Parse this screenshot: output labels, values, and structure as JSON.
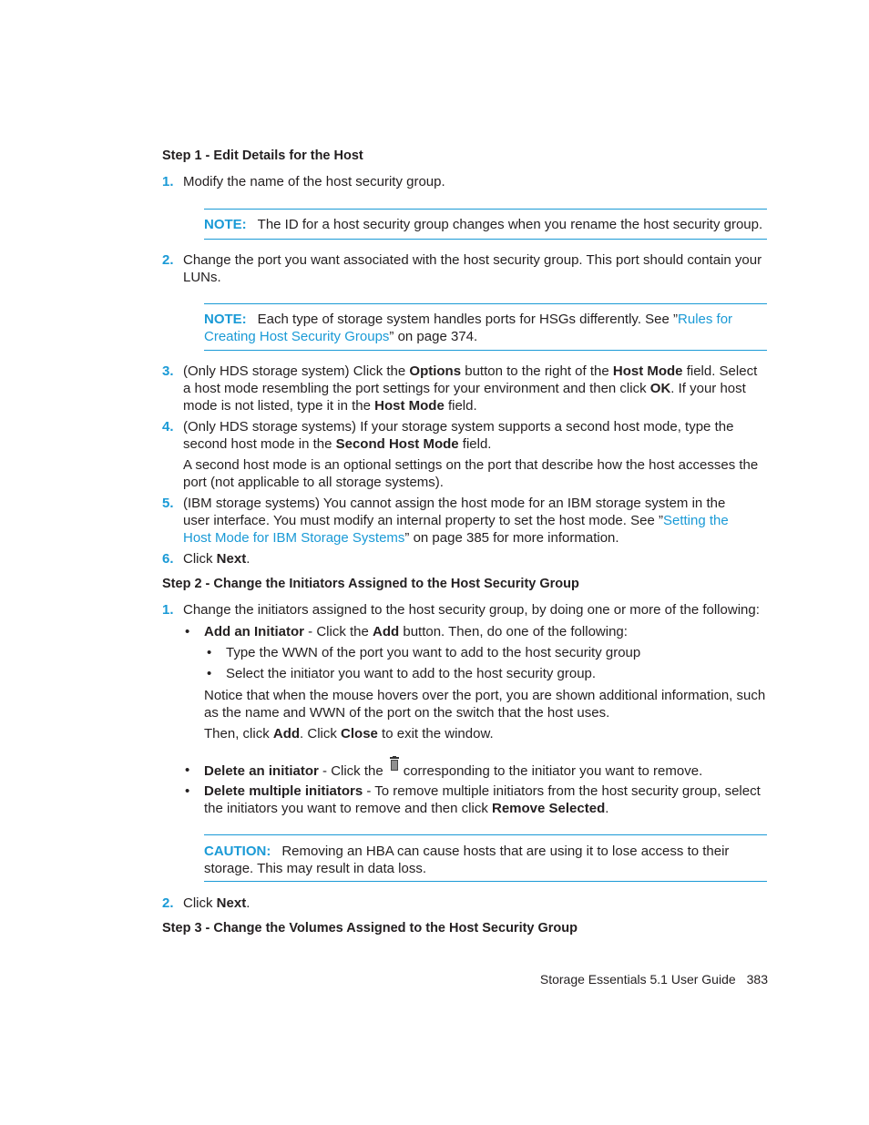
{
  "accent_color": "#1a9ad6",
  "step1": {
    "heading": "Step 1 - Edit Details for the Host",
    "items": [
      {
        "num": "1.",
        "runs": [
          {
            "t": "Modify the name of the host security group."
          }
        ]
      },
      {
        "num": "2.",
        "runs": [
          {
            "t": "Change the port you want associated with the host security group. This port should contain your LUNs."
          }
        ]
      },
      {
        "num": "3.",
        "runs": [
          {
            "t": "(Only HDS storage system) Click the "
          },
          {
            "t": "Options",
            "b": true
          },
          {
            "t": " button to the right of the "
          },
          {
            "t": "Host Mode",
            "b": true
          },
          {
            "t": " field. Select a host mode resembling the port settings for your environment and then click "
          },
          {
            "t": "OK",
            "b": true
          },
          {
            "t": ". If your host mode is not listed, type it in the "
          },
          {
            "t": "Host Mode",
            "b": true
          },
          {
            "t": " field."
          }
        ]
      },
      {
        "num": "4.",
        "runs": [
          {
            "t": "(Only HDS storage systems) If your storage system supports a second host mode, type the second host mode in the "
          },
          {
            "t": "Second Host Mode",
            "b": true
          },
          {
            "t": " field."
          }
        ]
      },
      {
        "num": "5.",
        "runs": [
          {
            "t": "(IBM storage systems) You cannot assign the host mode for an IBM storage system in the user interface. You must modify an internal property to set the host mode. See ”"
          },
          {
            "t": "Setting the Host Mode for IBM Storage Systems",
            "link": true
          },
          {
            "t": "” on page 385 for more information."
          }
        ]
      },
      {
        "num": "6.",
        "runs": [
          {
            "t": "Click "
          },
          {
            "t": "Next",
            "b": true
          },
          {
            "t": "."
          }
        ]
      }
    ],
    "item4_para": [
      {
        "t": "A second host mode is an optional settings on the port that describe how the host accesses the port (not applicable to all storage systems)."
      }
    ],
    "note1": {
      "label": "NOTE:",
      "runs": [
        {
          "t": "The ID for a host security group changes when you rename the host security group."
        }
      ]
    },
    "note2": {
      "label": "NOTE:",
      "runs": [
        {
          "t": "Each type of storage system handles ports for HSGs differently. See ”"
        },
        {
          "t": "Rules for Creating Host Security Groups",
          "link": true
        },
        {
          "t": "” on page 374."
        }
      ]
    }
  },
  "step2": {
    "heading": "Step 2 - Change the Initiators Assigned to the Host Security Group",
    "item1": {
      "num": "1.",
      "runs": [
        {
          "t": "Change the initiators assigned to the host security group, by doing one or more of the following:"
        }
      ]
    },
    "bullet_add": [
      {
        "t": "Add an Initiator",
        "b": true
      },
      {
        "t": " - Click the "
      },
      {
        "t": "Add",
        "b": true
      },
      {
        "t": " button. Then, do one of the following:"
      }
    ],
    "sub_bullets": [
      [
        {
          "t": "Type the WWN of the port you want to add to the host security group"
        }
      ],
      [
        {
          "t": "Select the initiator you want to add to the host security group."
        }
      ]
    ],
    "notice": [
      {
        "t": "Notice that when the mouse hovers over the port, you are shown additional information, such as the name and WWN of the port on the switch that the host uses."
      }
    ],
    "then": [
      {
        "t": "Then, click "
      },
      {
        "t": "Add",
        "b": true
      },
      {
        "t": ". Click "
      },
      {
        "t": "Close",
        "b": true
      },
      {
        "t": " to exit the window."
      }
    ],
    "bullet_delete_pre": [
      {
        "t": "Delete an initiator",
        "b": true
      },
      {
        "t": " - Click the"
      }
    ],
    "trash_icon": "trash-icon",
    "bullet_delete_post": [
      {
        "t": "corresponding to the initiator you want to remove."
      }
    ],
    "bullet_multi": [
      {
        "t": "Delete multiple initiators",
        "b": true
      },
      {
        "t": " - To remove multiple initiators from the host security group, select the initiators you want to remove and then click "
      },
      {
        "t": "Remove Selected",
        "b": true
      },
      {
        "t": "."
      }
    ],
    "caution": {
      "label": "CAUTION:",
      "runs": [
        {
          "t": "Removing an HBA can cause hosts that are using it to lose access to their storage. This may result in data loss."
        }
      ]
    },
    "item2": {
      "num": "2.",
      "runs": [
        {
          "t": "Click "
        },
        {
          "t": "Next",
          "b": true
        },
        {
          "t": "."
        }
      ]
    }
  },
  "step3": {
    "heading": "Step 3 - Change the Volumes Assigned to the Host Security Group"
  },
  "footer": {
    "guide": "Storage Essentials 5.1 User Guide",
    "page": "383"
  }
}
